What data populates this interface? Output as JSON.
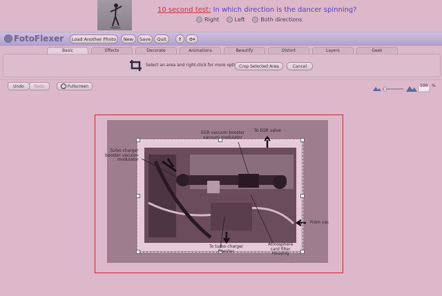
{
  "banner": {
    "link_text": "10 second test:",
    "question": "In which direction is the dancer spinning?",
    "options": [
      "Right",
      "Left",
      "Both directions"
    ]
  },
  "app": {
    "logo": "FotoFlexer",
    "toolbar": [
      "Load Another Photo",
      "New",
      "Save",
      "Quit",
      "?",
      "⚙▾"
    ]
  },
  "tabs": [
    "Basic",
    "Effects",
    "Decorate",
    "Animations",
    "Beautify",
    "Distort",
    "Layers",
    "Geek"
  ],
  "active_tab": "Basic",
  "crop_panel": {
    "instruction": "Select an area and right-click for more options.",
    "crop_button": "Crop Selected Area",
    "cancel_button": "Cancel"
  },
  "edit_bar": {
    "undo": "Undo",
    "redo": "Redo",
    "fullscreen": "Fullscreen",
    "zoom_value": "100",
    "zoom_unit": "%"
  },
  "photo_labels": {
    "egr_vacuum": [
      "EGR vacuum booster",
      "vacuum modulator"
    ],
    "to_egr": "To EGR valve",
    "turbo_booster": [
      "Turbo charger",
      "booster vacuum",
      "modulator"
    ],
    "from_vacuum": "From vac",
    "to_turbo": [
      "To turbo charger",
      "booster"
    ],
    "atmosphere": [
      "Atmosphere",
      "card filter",
      "Housing"
    ]
  },
  "colors": {
    "background": "#dcb8ca",
    "link": "#cc3344",
    "question": "#5540b8",
    "frame": "#cc2233"
  }
}
